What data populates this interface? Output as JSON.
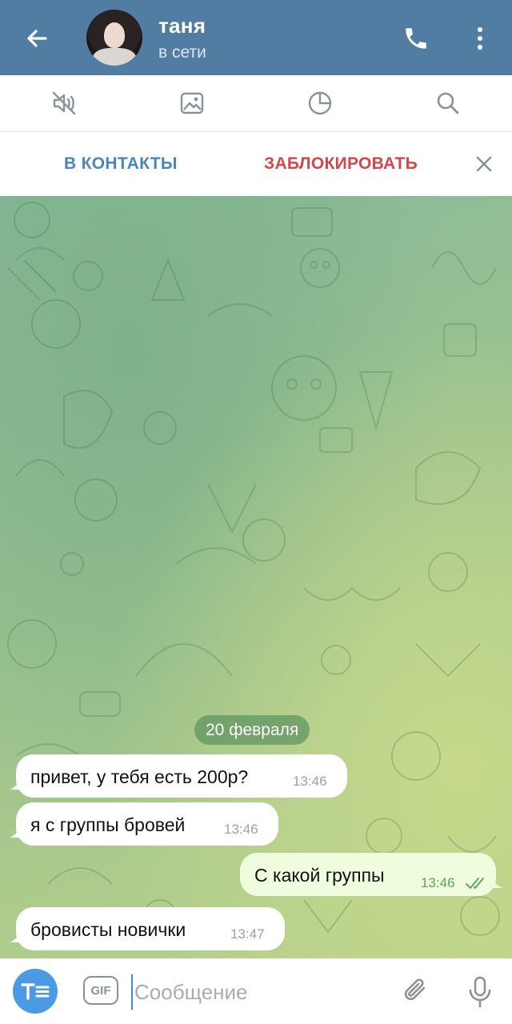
{
  "header": {
    "title": "таня",
    "status": "в сети",
    "back_icon": "arrow-left-icon",
    "call_icon": "phone-icon",
    "more_icon": "more-vertical-icon"
  },
  "toolbar": {
    "icons": [
      "mute-icon",
      "gallery-icon",
      "timer-icon",
      "search-icon"
    ]
  },
  "actions": {
    "add_contact": "В КОНТАКТЫ",
    "block": "ЗАБЛОКИРОВАТЬ"
  },
  "chat": {
    "date": "20 февраля",
    "messages": [
      {
        "direction": "in",
        "text": "привет, у тебя есть 200р?",
        "time": "13:46"
      },
      {
        "direction": "in",
        "text": "я с группы бровей",
        "time": "13:46"
      },
      {
        "direction": "out",
        "text": "С какой группы",
        "time": "13:46"
      },
      {
        "direction": "in",
        "text": "бровисты новички",
        "time": "13:47"
      }
    ]
  },
  "composer": {
    "placeholder": "Сообщение",
    "format_icon": "text-format-icon",
    "gif_label": "GIF",
    "attach_icon": "paperclip-icon",
    "mic_icon": "microphone-icon"
  },
  "colors": {
    "header_bg": "#517da2",
    "accent": "#4a86ba",
    "danger": "#d0484a",
    "outgoing_bubble": "#effdde"
  }
}
